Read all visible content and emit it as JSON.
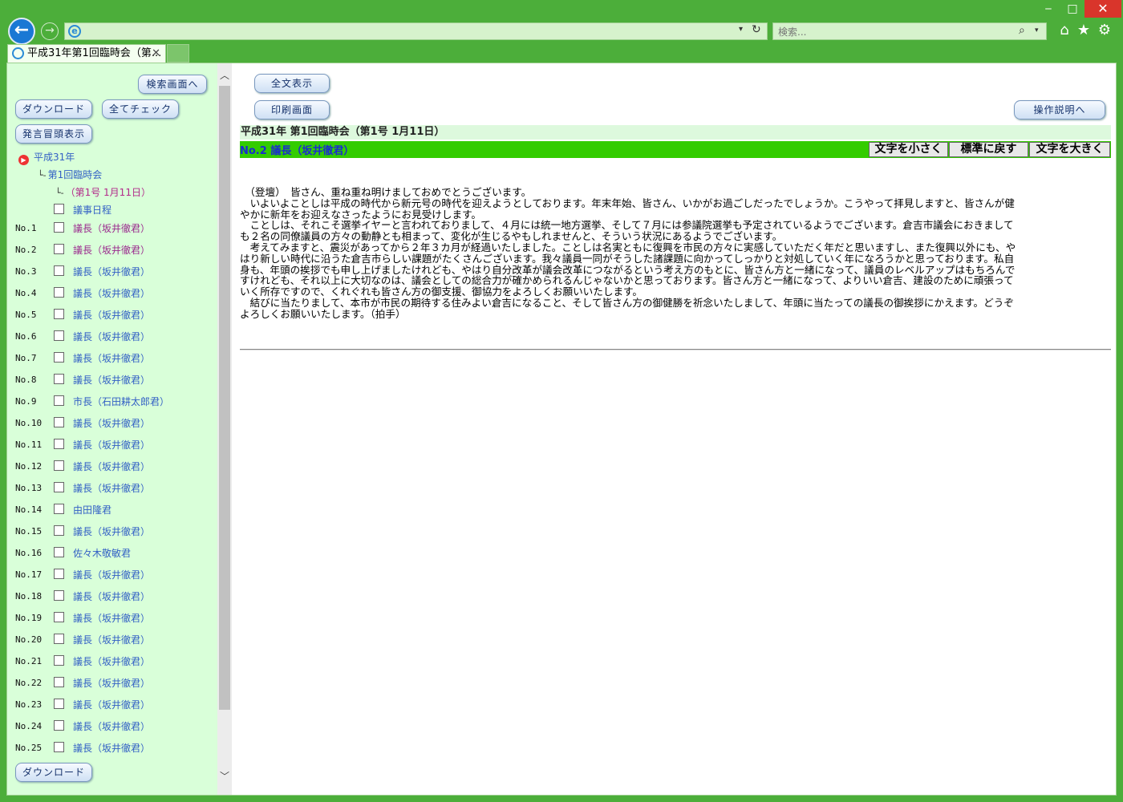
{
  "browser": {
    "window_controls": {
      "minimize": "‒",
      "maximize": "□",
      "close": "✕"
    },
    "search_placeholder": "検索...",
    "tab_title": "平成31年第1回臨時会（第...",
    "tab_close": "✕"
  },
  "left": {
    "search_screen_button": "検索画面へ",
    "download_button": "ダウンロード",
    "check_all_button": "全てチェック",
    "show_opening_button": "発言冒頭表示",
    "download_bottom_button": "ダウンロード",
    "tree": {
      "year": "平成31年",
      "session": "第1回臨時会",
      "sitting": "（第1号 1月11日）",
      "branch1": "└-",
      "branch2": "└-"
    },
    "agenda_label": "議事日程",
    "items": [
      {
        "num": "No.1",
        "label": "議長（坂井徹君）"
      },
      {
        "num": "No.2",
        "label": "議長（坂井徹君）"
      },
      {
        "num": "No.3",
        "label": "議長（坂井徹君）"
      },
      {
        "num": "No.4",
        "label": "議長（坂井徹君）"
      },
      {
        "num": "No.5",
        "label": "議長（坂井徹君）"
      },
      {
        "num": "No.6",
        "label": "議長（坂井徹君）"
      },
      {
        "num": "No.7",
        "label": "議長（坂井徹君）"
      },
      {
        "num": "No.8",
        "label": "議長（坂井徹君）"
      },
      {
        "num": "No.9",
        "label": "市長（石田耕太郎君）"
      },
      {
        "num": "No.10",
        "label": "議長（坂井徹君）"
      },
      {
        "num": "No.11",
        "label": "議長（坂井徹君）"
      },
      {
        "num": "No.12",
        "label": "議長（坂井徹君）"
      },
      {
        "num": "No.13",
        "label": "議長（坂井徹君）"
      },
      {
        "num": "No.14",
        "label": "由田隆君"
      },
      {
        "num": "No.15",
        "label": "議長（坂井徹君）"
      },
      {
        "num": "No.16",
        "label": "佐々木敬敏君"
      },
      {
        "num": "No.17",
        "label": "議長（坂井徹君）"
      },
      {
        "num": "No.18",
        "label": "議長（坂井徹君）"
      },
      {
        "num": "No.19",
        "label": "議長（坂井徹君）"
      },
      {
        "num": "No.20",
        "label": "議長（坂井徹君）"
      },
      {
        "num": "No.21",
        "label": "議長（坂井徹君）"
      },
      {
        "num": "No.22",
        "label": "議長（坂井徹君）"
      },
      {
        "num": "No.23",
        "label": "議長（坂井徹君）"
      },
      {
        "num": "No.24",
        "label": "議長（坂井徹君）"
      },
      {
        "num": "No.25",
        "label": "議長（坂井徹君）"
      }
    ]
  },
  "right": {
    "full_text_button": "全文表示",
    "print_button": "印刷画面",
    "help_button": "操作説明へ",
    "meeting_title": "平成31年 第1回臨時会（第1号 1月11日）",
    "speaker": "No.2 議長（坂井徹君）",
    "font_smaller": "文字を小さく",
    "font_reset": "標準に戻す",
    "font_larger": "文字を大きく",
    "body_lines": [
      "　（登壇）　皆さん、重ね重ね明けましておめでとうございます。",
      "　いよいよことしは平成の時代から新元号の時代を迎えようとしております。年末年始、皆さん、いかがお過ごしだったでしょうか。こうやって拝見しますと、皆さんが健",
      "やかに新年をお迎えなさったようにお見受けします。",
      "　ことしは、それこそ選挙イヤーと言われておりまして、４月には統一地方選挙、そして７月には参議院選挙も予定されているようでございます。倉吉市議会におきまして",
      "も２名の同僚議員の方々の動静とも相まって、変化が生じるやもしれませんと、そういう状況にあるようでございます。",
      "　考えてみますと、震災があってから２年３カ月が経過いたしました。ことしは名実ともに復興を市民の方々に実感していただく年だと思いますし、また復興以外にも、や",
      "はり新しい時代に沿うた倉吉市らしい課題がたくさんございます。我々議員一同がそうした諸課題に向かってしっかりと対処していく年になろうかと思っております。私自",
      "身も、年頭の挨拶でも申し上げましたけれども、やはり自分改革が議会改革につながるという考え方のもとに、皆さん方と一緒になって、議員のレベルアップはもちろんで",
      "すけれども、それ以上に大切なのは、議会としての総合力が確かめられるんじゃないかと思っております。皆さん方と一緒になって、よりいい倉吉、建設のために頑張って",
      "いく所存ですので、くれぐれも皆さん方の御支援、御協力をよろしくお願いいたします。",
      "　結びに当たりまして、本市が市民の期待する住みよい倉吉になること、そして皆さん方の御健勝を祈念いたしまして、年頭に当たっての議長の御挨拶にかえます。どうぞ",
      "よろしくお願いいたします。（拍手）"
    ]
  },
  "colors": {
    "chrome": "#4cae3a",
    "left_pane_bg": "#d9ffd9",
    "speaker_bar": "#33cc00",
    "title_bar": "#ddf9dd",
    "link": "#3360c5",
    "visited_link": "#9b2a8e"
  }
}
